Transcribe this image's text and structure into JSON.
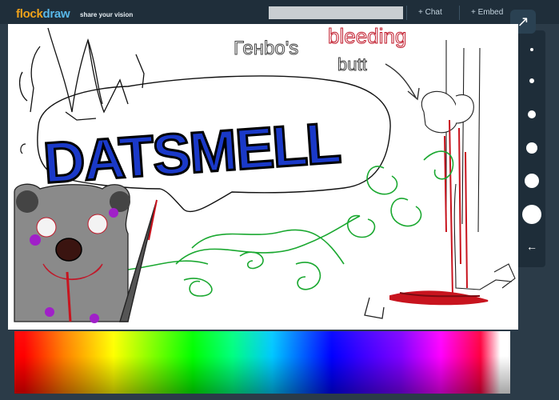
{
  "header": {
    "logo_part1": "flock",
    "logo_part2": "draw",
    "tagline": "share your vision",
    "search_value": "",
    "chat_label": "+ Chat",
    "embed_label": "+ Embed"
  },
  "canvas": {
    "drawing_text_cyrillic": "Генbо's",
    "drawing_text_bleeding": "bleeding",
    "drawing_text_butt": "butt",
    "drawing_text_main": "DATSMELL"
  },
  "toolbar": {
    "expand_icon": "expand-icon",
    "brush_sizes": [
      "brush-size-1",
      "brush-size-2",
      "brush-size-3",
      "brush-size-4",
      "brush-size-5",
      "brush-size-6"
    ],
    "undo_glyph": "←"
  },
  "colors": {
    "accent_orange": "#f0a21a",
    "accent_blue": "#58b7e8",
    "header_bg": "#1f2e3a",
    "page_bg": "#2b3b48"
  }
}
